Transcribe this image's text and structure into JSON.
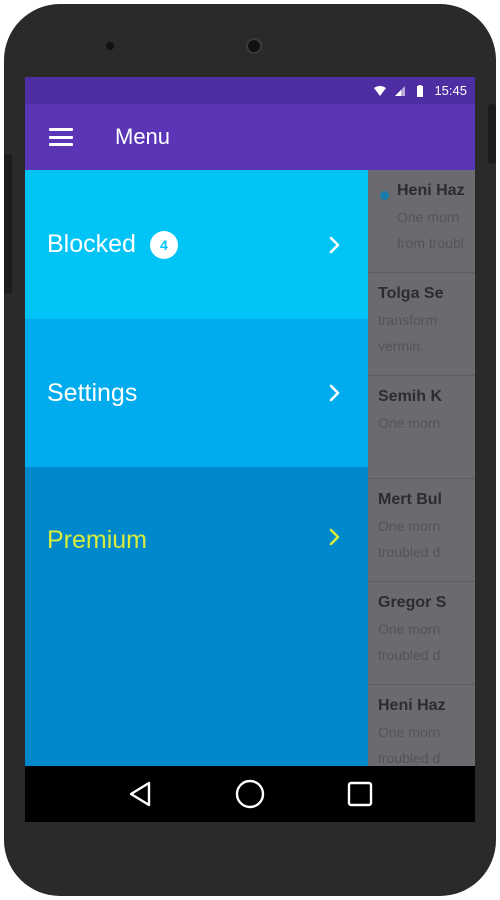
{
  "status_bar": {
    "time": "15:45"
  },
  "app_bar": {
    "title": "Menu",
    "menu_icon": "hamburger-menu-icon"
  },
  "drawer": {
    "items": [
      {
        "label": "Blocked",
        "badge": "4",
        "color": "#00c4f5"
      },
      {
        "label": "Settings",
        "color": "#00aced"
      },
      {
        "label": "Premium",
        "color": "#0088cc",
        "label_color": "#d9ec3c"
      }
    ]
  },
  "conversations": [
    {
      "name": "Heni Haz",
      "preview_lines": [
        "One morn",
        "from troubl"
      ],
      "unread": true
    },
    {
      "name": "Tolga Se",
      "preview_lines": [
        "transform",
        "vermin."
      ]
    },
    {
      "name": "Semih K",
      "preview_lines": [
        "One morn"
      ]
    },
    {
      "name": "Mert Bul",
      "preview_lines": [
        "One morn",
        "troubled d"
      ]
    },
    {
      "name": "Gregor S",
      "preview_lines": [
        "One morn",
        "troubled d"
      ]
    },
    {
      "name": "Heni Haz",
      "preview_lines": [
        "One morn",
        "troubled d"
      ]
    }
  ],
  "colors": {
    "status_bar": "#4f2da3",
    "app_bar": "#5a35b5",
    "premium_label": "#d9ec3c"
  },
  "nav_bar": {
    "icons": [
      "back-icon",
      "home-icon",
      "recents-icon"
    ]
  }
}
